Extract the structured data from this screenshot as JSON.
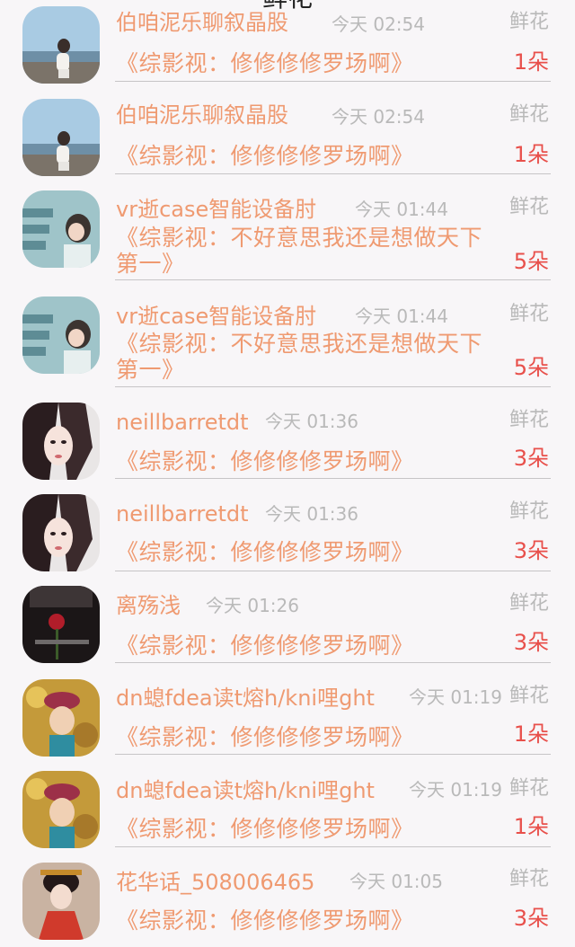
{
  "header": {
    "title": "鲜花"
  },
  "items": [
    {
      "name": "伯咱泥乐聊叙晶股",
      "time": "今天 02:54",
      "gift_type": "鲜花",
      "message": "《综影视：修修修修罗场啊》",
      "count": "1朵",
      "avatar_icon": "avatar-girl-seaside"
    },
    {
      "name": "伯咱泥乐聊叙晶股",
      "time": "今天 02:54",
      "gift_type": "鲜花",
      "message": "《综影视：修修修修罗场啊》",
      "count": "1朵",
      "avatar_icon": "avatar-girl-seaside"
    },
    {
      "name": "vr逝case智能设备肘",
      "time": "今天 01:44",
      "gift_type": "鲜花",
      "message": "《综影视：不好意思我还是想做天下第一》",
      "count": "5朵",
      "avatar_icon": "avatar-girl-classroom"
    },
    {
      "name": "vr逝case智能设备肘",
      "time": "今天 01:44",
      "gift_type": "鲜花",
      "message": "《综影视：不好意思我还是想做天下第一》",
      "count": "5朵",
      "avatar_icon": "avatar-girl-classroom"
    },
    {
      "name": "neillbarretdt",
      "time": "今天 01:36",
      "gift_type": "鲜花",
      "message": "《综影视：修修修修罗场啊》",
      "count": "3朵",
      "avatar_icon": "avatar-girl-portrait"
    },
    {
      "name": "neillbarretdt",
      "time": "今天 01:36",
      "gift_type": "鲜花",
      "message": "《综影视：修修修修罗场啊》",
      "count": "3朵",
      "avatar_icon": "avatar-girl-portrait"
    },
    {
      "name": "离殇浅",
      "time": "今天 01:26",
      "gift_type": "鲜花",
      "message": "《综影视：修修修修罗场啊》",
      "count": "3朵",
      "avatar_icon": "avatar-rose"
    },
    {
      "name": "dn螅fdea读t熔h/kni哩ght",
      "time": "今天 01:19",
      "gift_type": "鲜花",
      "message": "《综影视：修修修修罗场啊》",
      "count": "1朵",
      "avatar_icon": "avatar-girl-autumn"
    },
    {
      "name": "dn螅fdea读t熔h/kni哩ght",
      "time": "今天 01:19",
      "gift_type": "鲜花",
      "message": "《综影视：修修修修罗场啊》",
      "count": "1朵",
      "avatar_icon": "avatar-girl-autumn"
    },
    {
      "name": "花华话_508006465",
      "time": "今天 01:05",
      "gift_type": "鲜花",
      "message": "《综影视：修修修修罗场啊》",
      "count": "3朵",
      "avatar_icon": "avatar-girl-hanfu"
    }
  ]
}
